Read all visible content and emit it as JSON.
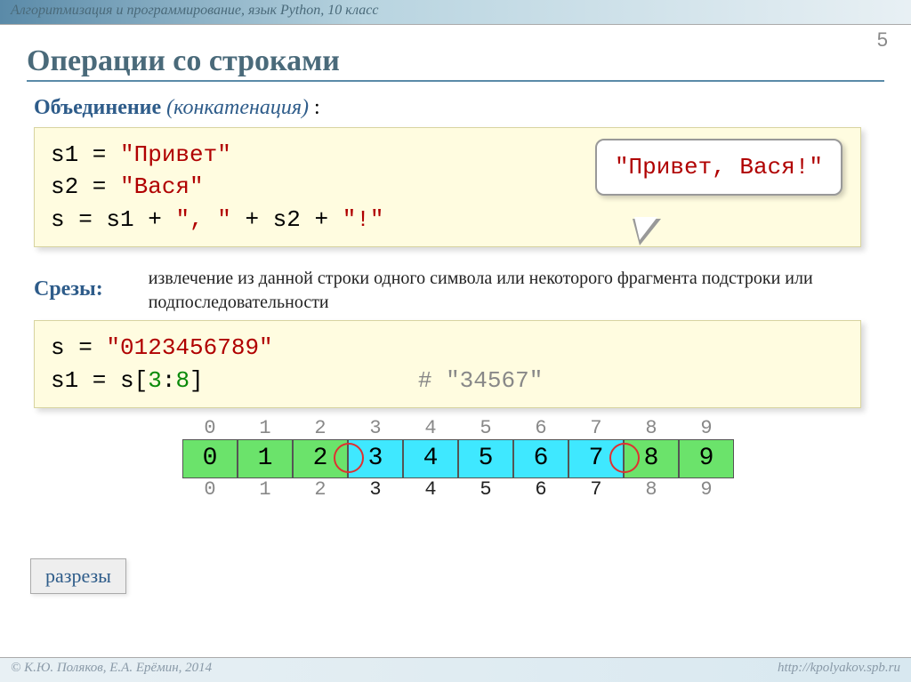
{
  "header": "Алгоритмизация и программирование, язык Python, 10 класс",
  "page_number": "5",
  "title": "Операции со строками",
  "concat": {
    "term": "Объединение",
    "italic": "(конкатенация)",
    "colon": " :",
    "code_lines": [
      {
        "pre": "s1 = ",
        "str": "\"Привет\""
      },
      {
        "pre": "s2 = ",
        "str": "\"Вася\""
      },
      {
        "pre": "s  = s1 + ",
        "str1": "\", \"",
        "mid": " + s2 + ",
        "str2": "\"!\""
      }
    ],
    "bubble": "\"Привет, Вася!\""
  },
  "slices": {
    "term": "Срезы:",
    "desc": "извлечение из данной строки одного символа или некоторого фрагмента подстроки или подпоследовательности",
    "code": {
      "line1_pre": "s = ",
      "line1_str": "\"0123456789\"",
      "line2_pre": "s1 = s[",
      "line2_a": "3",
      "line2_sep": ":",
      "line2_b": "8",
      "line2_close": "]",
      "comment": "# \"34567\""
    },
    "indices": [
      "0",
      "1",
      "2",
      "3",
      "4",
      "5",
      "6",
      "7",
      "8",
      "9"
    ],
    "chars": [
      "0",
      "1",
      "2",
      "3",
      "4",
      "5",
      "6",
      "7",
      "8",
      "9"
    ],
    "selected_start": 3,
    "selected_end": 7,
    "cut_label": "разрезы"
  },
  "footer": {
    "left": "© К.Ю. Поляков, Е.А. Ерёмин, 2014",
    "right": "http://kpolyakov.spb.ru"
  }
}
